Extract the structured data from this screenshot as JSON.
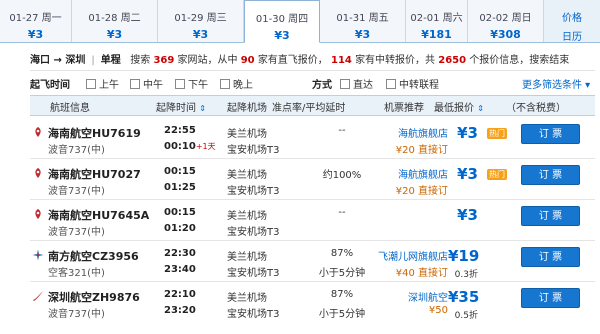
{
  "date_tabs": [
    {
      "date": "01-27 周一",
      "price": "¥3"
    },
    {
      "date": "01-28 周二",
      "price": "¥3"
    },
    {
      "date": "01-29 周三",
      "price": "¥3"
    },
    {
      "date": "01-30 周四",
      "price": "¥3"
    },
    {
      "date": "01-31 周五",
      "price": "¥3"
    },
    {
      "date": "02-01 周六",
      "price": "¥181"
    },
    {
      "date": "02-02 周日",
      "price": "¥308"
    }
  ],
  "calendar": {
    "line1": "价格",
    "line2": "日历"
  },
  "summary": {
    "route": "海口 → 深圳",
    "trip_type": "单程",
    "t1": "搜索",
    "c1": "369",
    "t2": "家网站，从中",
    "c2": "90",
    "t3": "家有直飞报价，",
    "c3": "114",
    "t4": "家有中转报价，共",
    "c4": "2650",
    "t5": "个报价信息，搜索结束"
  },
  "filters": {
    "takeoff_label": "起飞时间",
    "times": [
      "上午",
      "中午",
      "下午",
      "晚上"
    ],
    "mode_label": "方式",
    "modes": [
      "直达",
      "中转联程"
    ],
    "more": "更多筛选条件 ▾"
  },
  "headers": {
    "flight": "航班信息",
    "time": "起降时间",
    "airport": "起降机场",
    "punctual": "准点率/平均延时",
    "agent": "机票推荐",
    "lowest": "最低报价",
    "tax_note": "（不含税费）",
    "sort_icon": "⇕"
  },
  "hot_label": "热门",
  "book_label": "订 票",
  "rows": [
    {
      "airline": "海南航空HU7619",
      "plane": "波音737(中)",
      "dep": "22:55",
      "arr": "00:10",
      "plus": "+1天",
      "ap_dep": "美兰机场",
      "ap_arr": "宝安机场T3",
      "p1": "--",
      "p2": "",
      "agent": "海航旗舰店",
      "agent_note": "¥20 直接订",
      "price": "¥3",
      "disc": "",
      "hot": true,
      "logo": "hainan"
    },
    {
      "airline": "海南航空HU7027",
      "plane": "波音737(中)",
      "dep": "00:15",
      "arr": "01:25",
      "plus": "",
      "ap_dep": "美兰机场",
      "ap_arr": "宝安机场T3",
      "p1": "约100%",
      "p2": "",
      "agent": "海航旗舰店",
      "agent_note": "¥20 直接订",
      "price": "¥3",
      "disc": "",
      "hot": true,
      "logo": "hainan"
    },
    {
      "airline": "海南航空HU7645A",
      "plane": "波音737(中)",
      "dep": "00:15",
      "arr": "01:20",
      "plus": "",
      "ap_dep": "美兰机场",
      "ap_arr": "宝安机场T3",
      "p1": "--",
      "p2": "",
      "agent": "",
      "agent_note": "",
      "price": "¥3",
      "disc": "",
      "hot": false,
      "logo": "hainan"
    },
    {
      "airline": "南方航空CZ3956",
      "plane": "空客321(中)",
      "dep": "22:30",
      "arr": "23:40",
      "plus": "",
      "ap_dep": "美兰机场",
      "ap_arr": "宝安机场T3",
      "p1": "87%",
      "p2": "小于5分钟",
      "agent": "飞潮儿网旗舰店",
      "agent_note": "¥40 直接订",
      "price": "¥19",
      "disc": "0.3折",
      "hot": false,
      "logo": "csair"
    },
    {
      "airline": "深圳航空ZH9876",
      "plane": "波音737(中)",
      "dep": "22:10",
      "arr": "23:20",
      "plus": "",
      "ap_dep": "美兰机场",
      "ap_arr": "宝安机场T3",
      "p1": "87%",
      "p2": "小于5分钟",
      "agent": "深圳航空",
      "agent_note": "¥50",
      "price": "¥35",
      "disc": "0.5折",
      "hot": false,
      "logo": "shenzhen"
    }
  ],
  "colors": {
    "price": "#0066cc",
    "hot": "#f7a11a",
    "book": "#1777d0",
    "hainan_logo": "#c0282d",
    "csair_logo": "#2a6fb5",
    "shenzhen_logo": "#c0282d"
  }
}
